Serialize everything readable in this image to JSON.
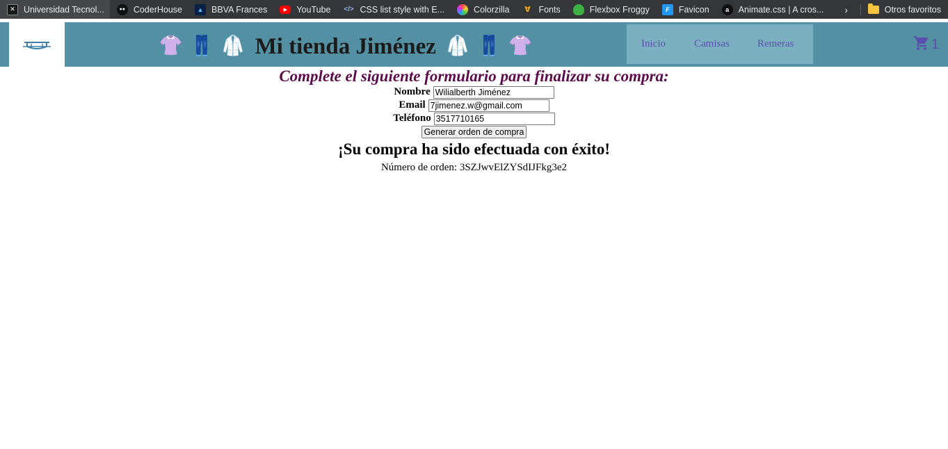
{
  "bookmarks": {
    "items": [
      {
        "label": "Universidad Tecnol...",
        "icon": "utn-icon"
      },
      {
        "label": "CoderHouse",
        "icon": "coderhouse-icon"
      },
      {
        "label": "BBVA Frances",
        "icon": "bbva-icon"
      },
      {
        "label": "YouTube",
        "icon": "youtube-icon"
      },
      {
        "label": "CSS list style with E...",
        "icon": "code-icon"
      },
      {
        "label": "Colorzilla",
        "icon": "colorzilla-icon"
      },
      {
        "label": "Fonts",
        "icon": "fonts-icon"
      },
      {
        "label": "Flexbox Froggy",
        "icon": "frog-icon"
      },
      {
        "label": "Favicon",
        "icon": "favicon-icon"
      },
      {
        "label": "Animate.css | A cros...",
        "icon": "amazon-icon"
      }
    ],
    "other_folder": "Otros favoritos"
  },
  "header": {
    "title": "Mi tienda Jiménez",
    "emojis_left": [
      "👚",
      "👖",
      "🥼"
    ],
    "emojis_right": [
      "🥼",
      "👖",
      "👚"
    ],
    "nav": [
      "Inicio",
      "Camisas",
      "Remeras"
    ],
    "cart_count": "1",
    "colors": {
      "header_bg": "#5390a3",
      "nav_bg": "#7ab0c0",
      "link": "#5b4fae"
    }
  },
  "form": {
    "title": "Complete el siguiente formulario para finalizar su compra:",
    "fields": {
      "nombre": {
        "label": "Nombre",
        "value": "Wilialberth Jiménez"
      },
      "email": {
        "label": "Email",
        "value": "7jimenez.w@gmail.com"
      },
      "telefono": {
        "label": "Teléfono",
        "value": "3517710165"
      }
    },
    "submit_label": "Generar orden de compra"
  },
  "result": {
    "message": "¡Su compra ha sido efectuada con éxito!",
    "order_label": "Número de orden:",
    "order_id": "3SZJwvElZYSdIJFkg3e2"
  }
}
